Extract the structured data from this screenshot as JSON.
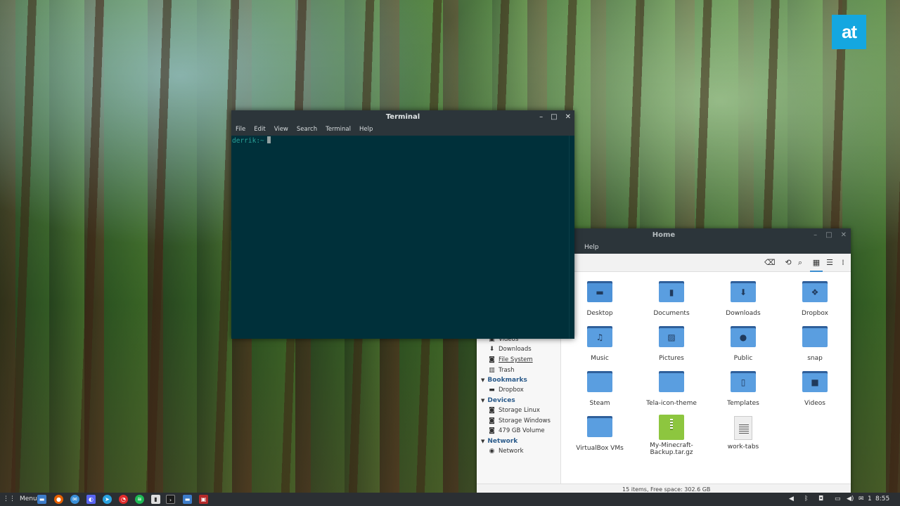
{
  "logo": {
    "text": "at"
  },
  "terminal": {
    "title": "Terminal",
    "menu": [
      "File",
      "Edit",
      "View",
      "Search",
      "Terminal",
      "Help"
    ],
    "prompt": "derrik:~"
  },
  "file_manager": {
    "title": "Home",
    "menu_visible": "Help",
    "sidebar": {
      "places": [
        {
          "label": "Videos",
          "icon": "video-icon"
        },
        {
          "label": "Downloads",
          "icon": "download-icon"
        },
        {
          "label": "File System",
          "icon": "disk-icon"
        },
        {
          "label": "Trash",
          "icon": "trash-icon"
        }
      ],
      "bookmarks_header": "Bookmarks",
      "bookmarks": [
        {
          "label": "Dropbox",
          "icon": "folder-icon"
        }
      ],
      "devices_header": "Devices",
      "devices": [
        {
          "label": "Storage Linux",
          "icon": "disk-icon"
        },
        {
          "label": "Storage Windows",
          "icon": "disk-icon"
        },
        {
          "label": "479 GB Volume",
          "icon": "disk-icon"
        }
      ],
      "network_header": "Network",
      "network": [
        {
          "label": "Network",
          "icon": "network-icon"
        }
      ]
    },
    "items": [
      {
        "label": "Desktop",
        "icon": "desktop-folder-icon"
      },
      {
        "label": "Documents",
        "icon": "documents-folder-icon"
      },
      {
        "label": "Downloads",
        "icon": "downloads-folder-icon"
      },
      {
        "label": "Dropbox",
        "icon": "dropbox-folder-icon"
      },
      {
        "label": "Music",
        "icon": "music-folder-icon"
      },
      {
        "label": "Pictures",
        "icon": "pictures-folder-icon"
      },
      {
        "label": "Public",
        "icon": "public-folder-icon"
      },
      {
        "label": "snap",
        "icon": "folder-icon"
      },
      {
        "label": "Steam",
        "icon": "folder-icon"
      },
      {
        "label": "Tela-icon-theme",
        "icon": "folder-icon"
      },
      {
        "label": "Templates",
        "icon": "templates-folder-icon"
      },
      {
        "label": "Videos",
        "icon": "videos-folder-icon"
      },
      {
        "label": "VirtualBox VMs",
        "icon": "folder-icon"
      },
      {
        "label": "My-Minecraft-Backup.tar.gz",
        "label_line1": "My-Minecraft-",
        "label_line2": "Backup.tar.gz",
        "icon": "archive-icon"
      },
      {
        "label": "work-tabs",
        "icon": "text-file-icon"
      }
    ],
    "status": "15 items, Free space: 302.6 GB"
  },
  "taskbar": {
    "menu_label": "Menu",
    "clock": "8:55 AM",
    "tray_count": "1"
  },
  "colors": {
    "terminal_bg": "#00303a",
    "prompt": "#2aa198",
    "titlebar": "#2c353a",
    "folder": "#5a9ee0",
    "logo": "#14a7e0",
    "archive": "#8dc63f"
  }
}
